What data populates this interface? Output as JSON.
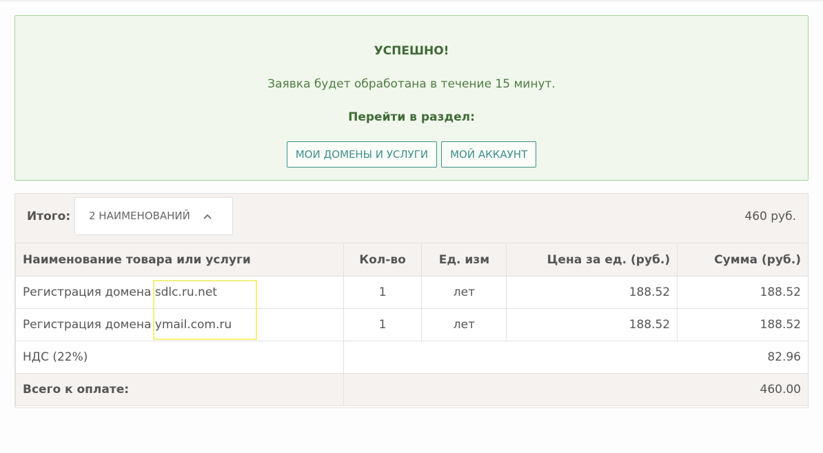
{
  "success": {
    "title": "УСПЕШНО!",
    "message": "Заявка будет обработана в течение 15 минут.",
    "goto_label": "Перейти в раздел:",
    "buttons": [
      {
        "label": "МОИ ДОМЕНЫ И УСЛУГИ"
      },
      {
        "label": "МОЙ АККАУНТ"
      }
    ]
  },
  "summary": {
    "total_label": "Итого:",
    "items_toggle_label": "2 НАИМЕНОВАНИЙ",
    "items_toggle_icon": "chevron-up-icon",
    "total_amount": "460  руб."
  },
  "table": {
    "columns": [
      "Наименование товара или услуги",
      "Кол-во",
      "Ед. изм",
      "Цена за ед. (руб.)",
      "Сумма (руб.)"
    ],
    "rows": [
      {
        "name": "Регистрация домена sdlc.ru.net",
        "qty": "1",
        "unit": "лет",
        "price": "188.52",
        "sum": "188.52"
      },
      {
        "name": "Регистрация домена ymail.com.ru",
        "qty": "1",
        "unit": "лет",
        "price": "188.52",
        "sum": "188.52"
      }
    ],
    "vat": {
      "label": "НДС (22%)",
      "value": "82.96"
    },
    "grand_total": {
      "label": "Всего к оплате:",
      "value": "460.00"
    }
  },
  "colors": {
    "success_bg": "#f1f7ec",
    "success_border": "#a8d39b",
    "success_text": "#3f6b36",
    "button_accent": "#3e8f89",
    "highlight": "#f1f07a"
  }
}
